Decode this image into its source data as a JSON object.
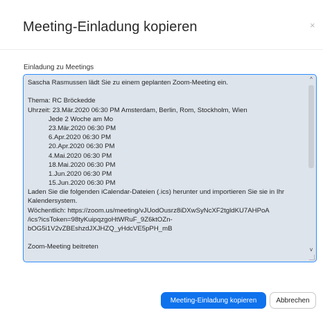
{
  "dialog": {
    "title": "Meeting-Einladung kopieren",
    "close_icon": "×",
    "field_label": "Einladung zu Meetings"
  },
  "invitation": {
    "lines": [
      {
        "text": "Sascha Rasmussen lädt Sie zu einem geplanten Zoom-Meeting ein.",
        "indent": false
      },
      {
        "text": "",
        "indent": false
      },
      {
        "text": "Thema: RC Bröckedde",
        "indent": false
      },
      {
        "text": "Uhrzeit: 23.Mär.2020 06:30 PM Amsterdam, Berlin, Rom, Stockholm, Wien",
        "indent": false
      },
      {
        "text": "Jede 2 Woche am Mo",
        "indent": true
      },
      {
        "text": "23.Mär.2020 06:30 PM",
        "indent": true
      },
      {
        "text": "6.Apr.2020 06:30 PM",
        "indent": true
      },
      {
        "text": "20.Apr.2020 06:30 PM",
        "indent": true
      },
      {
        "text": "4.Mai.2020 06:30 PM",
        "indent": true
      },
      {
        "text": "18.Mai.2020 06:30 PM",
        "indent": true
      },
      {
        "text": "1.Jun.2020 06:30 PM",
        "indent": true
      },
      {
        "text": "15.Jun.2020 06:30 PM",
        "indent": true
      },
      {
        "text": "Laden Sie die folgenden iCalendar-Dateien (.ics) herunter und importieren Sie sie in Ihr",
        "indent": false
      },
      {
        "text": "Kalendersystem.",
        "indent": false
      },
      {
        "text": "Wöchentlich: https://zoom.us/meeting/vJUodOusrz8iDXwSyNcXF2tgldKU7AHPoA",
        "indent": false
      },
      {
        "text": "/ics?icsToken=98tyKuipqzgoHtWRuF_9Z6ktOZn-",
        "indent": false
      },
      {
        "text": "bOG5i1V2vZBEshzdJXJHZQ_yHdcVE5pPH_mB",
        "indent": false
      },
      {
        "text": "",
        "indent": false
      },
      {
        "text": "Zoom-Meeting beitreten",
        "indent": false
      }
    ]
  },
  "scrollbar": {
    "up_icon": "^",
    "down_icon": "v"
  },
  "buttons": {
    "copy_label": "Meeting-Einladung kopieren",
    "cancel_label": "Abbrechen"
  },
  "colors": {
    "accent": "#0e72ed",
    "textarea_bg": "#dde4ec",
    "focus_border": "#2d8cff"
  }
}
